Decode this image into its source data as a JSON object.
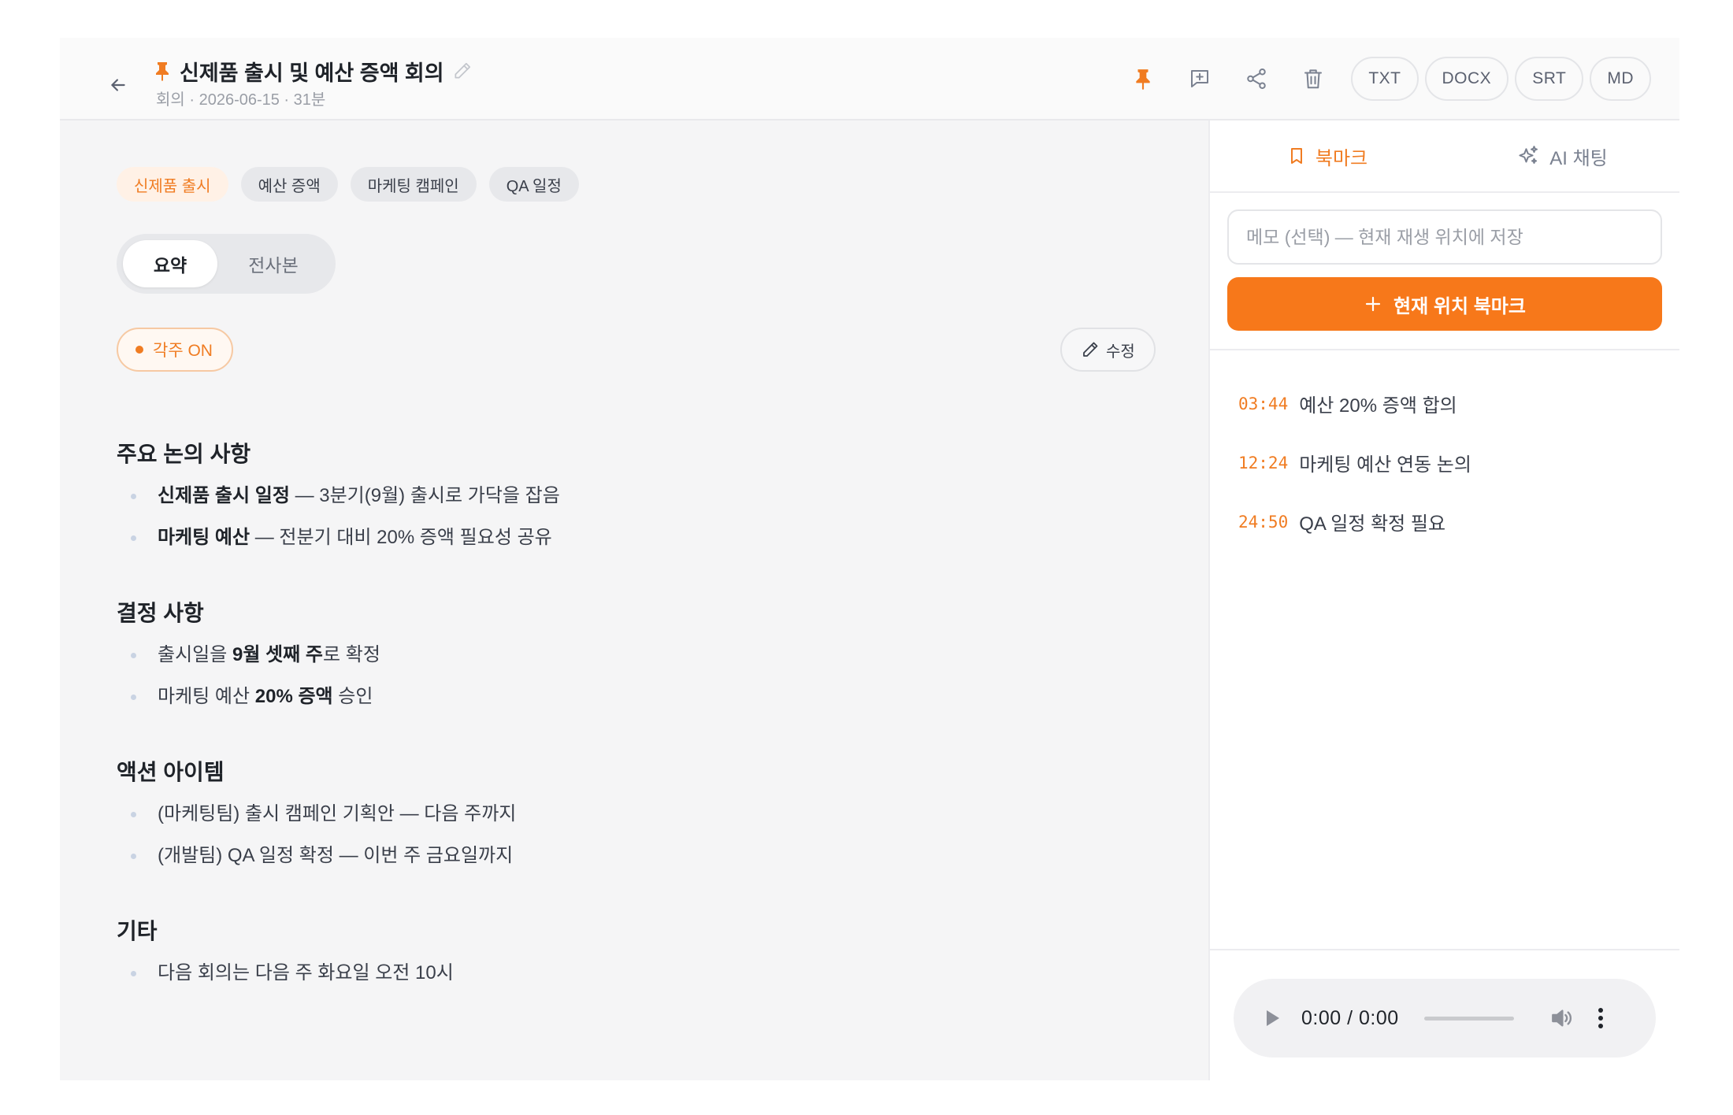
{
  "header": {
    "title": "신제품 출시 및 예산 증액 회의",
    "subtitle": "회의 · 2026-06-15 · 31분",
    "export_buttons": [
      "TXT",
      "DOCX",
      "SRT",
      "MD"
    ]
  },
  "tags": [
    {
      "label": "신제품 출시",
      "active": true
    },
    {
      "label": "예산 증액",
      "active": false
    },
    {
      "label": "마케팅 캠페인",
      "active": false
    },
    {
      "label": "QA 일정",
      "active": false
    }
  ],
  "view_tabs": {
    "summary": "요약",
    "transcript": "전사본"
  },
  "captions_toggle": "각주 ON",
  "edit_label": "수정",
  "sections": {
    "discussion": {
      "heading": "주요 논의 사항",
      "items": [
        {
          "bold": "신제품 출시 일정",
          "rest": " — 3분기(9월) 출시로 가닥을 잡음"
        },
        {
          "bold": "마케팅 예산",
          "rest": " — 전분기 대비 20% 증액 필요성 공유"
        }
      ]
    },
    "decisions": {
      "heading": "결정 사항",
      "items": [
        {
          "pre": "출시일을 ",
          "bold": "9월 셋째 주",
          "post": "로 확정"
        },
        {
          "pre": "마케팅 예산 ",
          "bold": "20% 증액",
          "post": " 승인"
        }
      ]
    },
    "actions": {
      "heading": "액션 아이템",
      "items": [
        "(마케팅팀) 출시 캠페인 기획안 — 다음 주까지",
        "(개발팀) QA 일정 확정 — 이번 주 금요일까지"
      ]
    },
    "other": {
      "heading": "기타",
      "items": [
        "다음 회의는 다음 주 화요일 오전 10시"
      ]
    }
  },
  "sidebar": {
    "tab_bookmarks": "북마크",
    "tab_ai_chat": "AI 채팅",
    "memo_placeholder": "메모 (선택) — 현재 재생 위치에 저장",
    "add_bookmark_label": "현재 위치 북마크",
    "bookmarks": [
      {
        "time": "03:44",
        "label": "예산 20% 증액 합의"
      },
      {
        "time": "12:24",
        "label": "마케팅 예산 연동 논의"
      },
      {
        "time": "24:50",
        "label": "QA 일정 확정 필요"
      }
    ]
  },
  "player": {
    "time": "0:00 / 0:00",
    "progress": 0
  },
  "colors": {
    "accent": "#f7781a",
    "accent_text": "#f07c22",
    "text_primary": "#1f2329",
    "text_secondary": "#9a9ea6",
    "panel_bg": "#f5f5f6"
  },
  "icons": {
    "back": "arrow-left-icon",
    "title_pin": "pin-icon",
    "title_edit": "pencil-icon",
    "pin": "pin-icon",
    "comment": "comment-plus-icon",
    "share": "share-icon",
    "delete": "trash-icon",
    "bookmark": "bookmark-icon",
    "ai": "sparkles-icon",
    "add": "plus-icon",
    "play": "play-icon",
    "volume": "volume-icon",
    "more": "more-vertical-icon"
  }
}
